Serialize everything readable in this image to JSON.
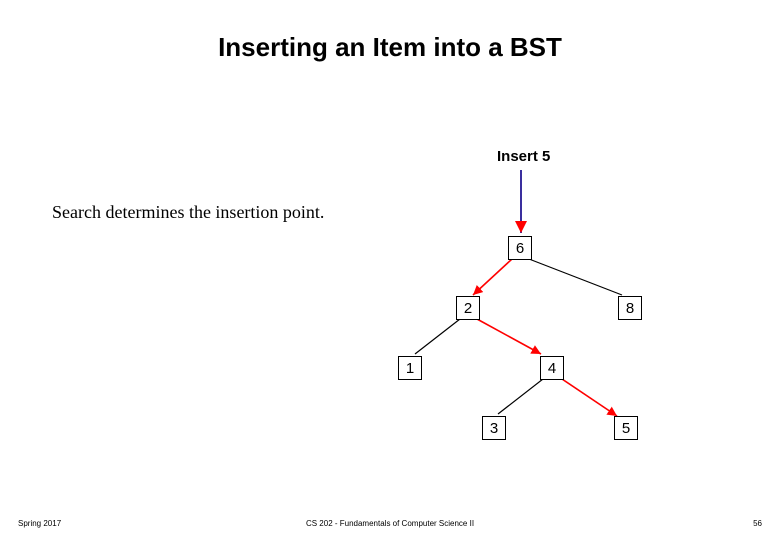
{
  "title": "Inserting an Item into a BST",
  "insert_label": "Insert 5",
  "search_note": "Search determines the insertion point.",
  "nodes": {
    "root": "6",
    "l": "2",
    "r": "8",
    "ll": "1",
    "lr": "4",
    "lrl": "3",
    "lrr": "5"
  },
  "footer": {
    "left": "Spring 2017",
    "center": "CS 202 - Fundamentals of Computer Science II",
    "right": "56"
  }
}
